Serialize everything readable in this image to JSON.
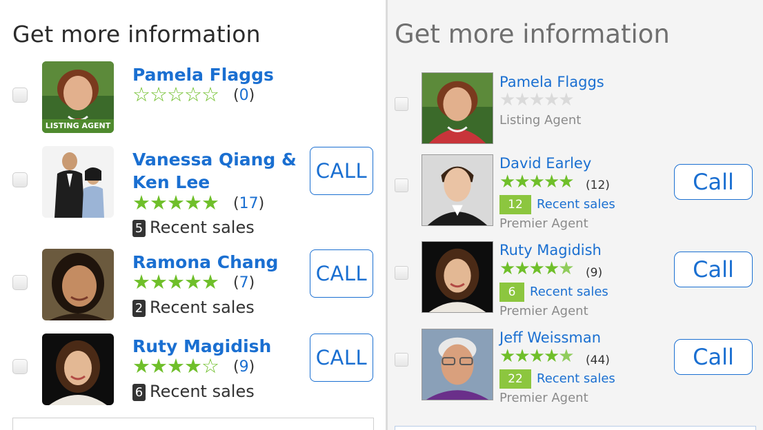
{
  "left": {
    "heading": "Get more information",
    "agents": [
      {
        "name_lines": [
          "Pamela Flaggs"
        ],
        "rating": 0,
        "star_style": "outline",
        "review_count": "0",
        "badge": "LISTING AGENT",
        "recent_sales": null,
        "call_label": null
      },
      {
        "name_lines": [
          "Vanessa Qiang &",
          "Ken Lee"
        ],
        "rating": 5,
        "star_style": "filled",
        "review_count": "17",
        "badge": null,
        "recent_sales": {
          "count": "5",
          "label": "Recent sales"
        },
        "call_label": "CALL"
      },
      {
        "name_lines": [
          "Ramona Chang"
        ],
        "rating": 5,
        "star_style": "filled",
        "review_count": "7",
        "badge": null,
        "recent_sales": {
          "count": "2",
          "label": "Recent sales"
        },
        "call_label": "CALL"
      },
      {
        "name_lines": [
          "Ruty Magidish"
        ],
        "rating": 4.5,
        "star_style": "filled",
        "review_count": "9",
        "badge": null,
        "recent_sales": {
          "count": "6",
          "label": "Recent sales"
        },
        "call_label": "CALL"
      }
    ]
  },
  "right": {
    "heading": "Get more information",
    "agents": [
      {
        "name": "Pamela Flaggs",
        "rating": 0,
        "review_count": null,
        "recent_sales": null,
        "role": "Listing Agent",
        "call_label": null
      },
      {
        "name": "David Earley",
        "rating": 5,
        "review_count": "12",
        "recent_sales": {
          "count": "12",
          "label": "Recent sales"
        },
        "role": "Premier Agent",
        "call_label": "Call"
      },
      {
        "name": "Ruty Magidish",
        "rating": 4.5,
        "review_count": "9",
        "recent_sales": {
          "count": "6",
          "label": "Recent sales"
        },
        "role": "Premier Agent",
        "call_label": "Call"
      },
      {
        "name": "Jeff Weissman",
        "rating": 4.5,
        "review_count": "44",
        "recent_sales": {
          "count": "22",
          "label": "Recent sales"
        },
        "role": "Premier Agent",
        "call_label": "Call"
      }
    ]
  },
  "colors": {
    "link_blue": "#1a6fd1",
    "star_green": "#6fbf2a",
    "sales_badge_green": "#8cc63f",
    "listing_badge_green": "#4f8a2e"
  }
}
